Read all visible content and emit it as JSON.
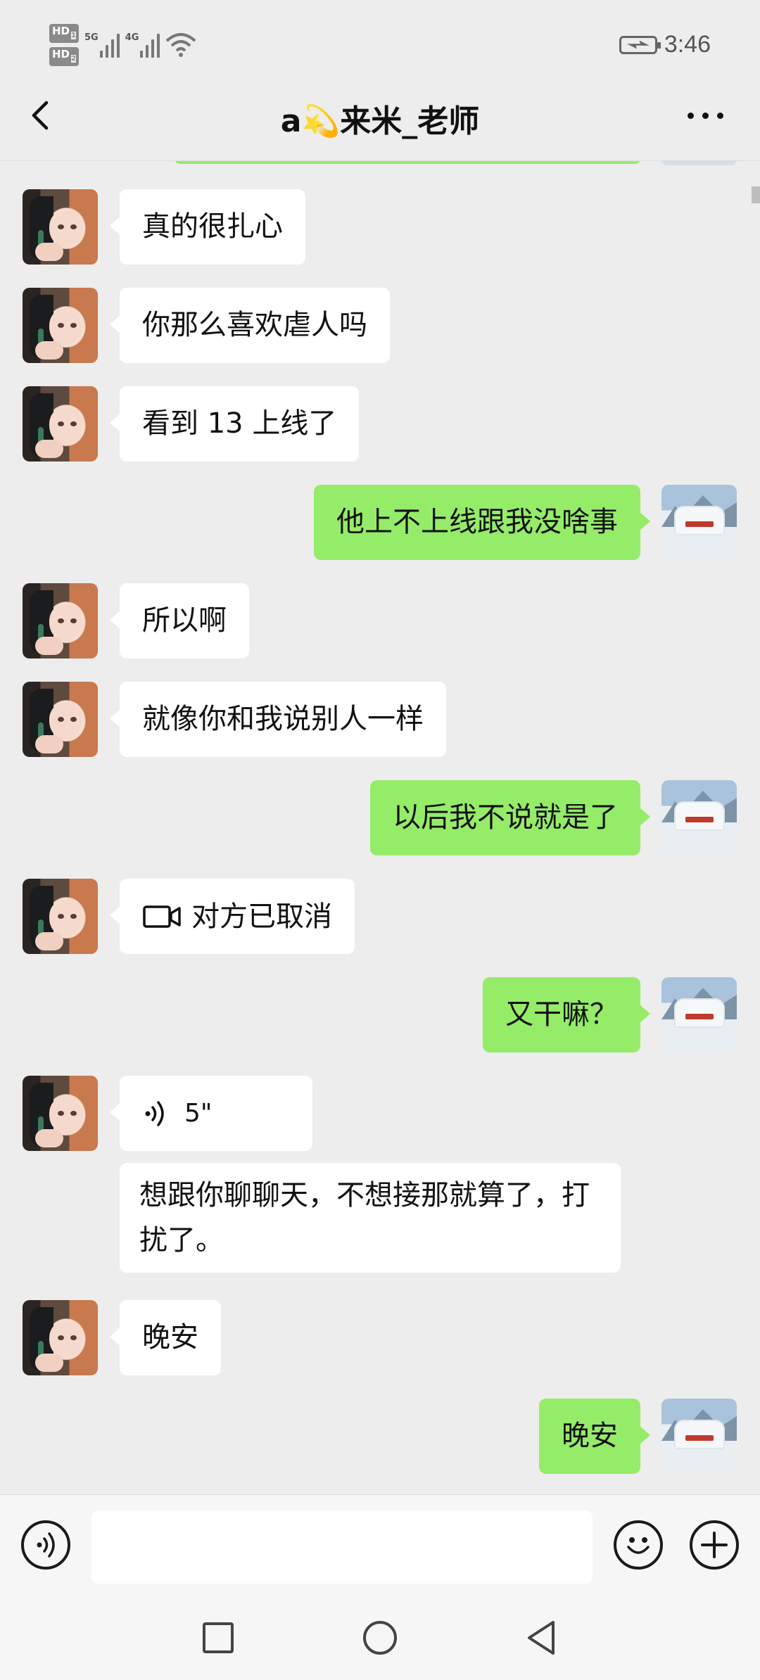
{
  "status_bar": {
    "hd1": "HD",
    "hd1_sub": "1",
    "hd2": "HD",
    "hd2_sub": "2",
    "sim1_network": "5G",
    "sim2_network": "4G",
    "time": "3:46"
  },
  "header": {
    "title_prefix": "a",
    "title_emoji": "💫",
    "title_suffix": "来米_老师"
  },
  "messages": [
    {
      "sender": "contact",
      "type": "text",
      "text": "真的很扎心"
    },
    {
      "sender": "contact",
      "type": "text",
      "text": "你那么喜欢虐人吗"
    },
    {
      "sender": "contact",
      "type": "text",
      "text": "看到 13 上线了"
    },
    {
      "sender": "me",
      "type": "text",
      "text": "他上不上线跟我没啥事"
    },
    {
      "sender": "contact",
      "type": "text",
      "text": "所以啊"
    },
    {
      "sender": "contact",
      "type": "text",
      "text": "就像你和我说别人一样"
    },
    {
      "sender": "me",
      "type": "text",
      "text": "以后我不说就是了"
    },
    {
      "sender": "contact",
      "type": "video_call",
      "text": "对方已取消"
    },
    {
      "sender": "me",
      "type": "text",
      "text": "又干嘛？"
    },
    {
      "sender": "contact",
      "type": "voice",
      "text": "5\""
    },
    {
      "sender": "contact",
      "type": "text",
      "text": "想跟你聊聊天，不想接那就算了，打扰了。"
    },
    {
      "sender": "contact",
      "type": "text",
      "text": "晚安"
    },
    {
      "sender": "me",
      "type": "text",
      "text": "晚安"
    }
  ],
  "input_bar": {
    "placeholder": ""
  },
  "colors": {
    "background": "#ededed",
    "outgoing_bubble": "#95ec69",
    "incoming_bubble": "#ffffff"
  },
  "icons": {
    "back": "chevron-left-icon",
    "more": "more-dots-icon",
    "voice_toggle": "voice-icon",
    "emoji": "emoji-icon",
    "plus": "plus-icon",
    "video_call": "video-camera-icon",
    "voice_message": "voice-wave-icon"
  }
}
